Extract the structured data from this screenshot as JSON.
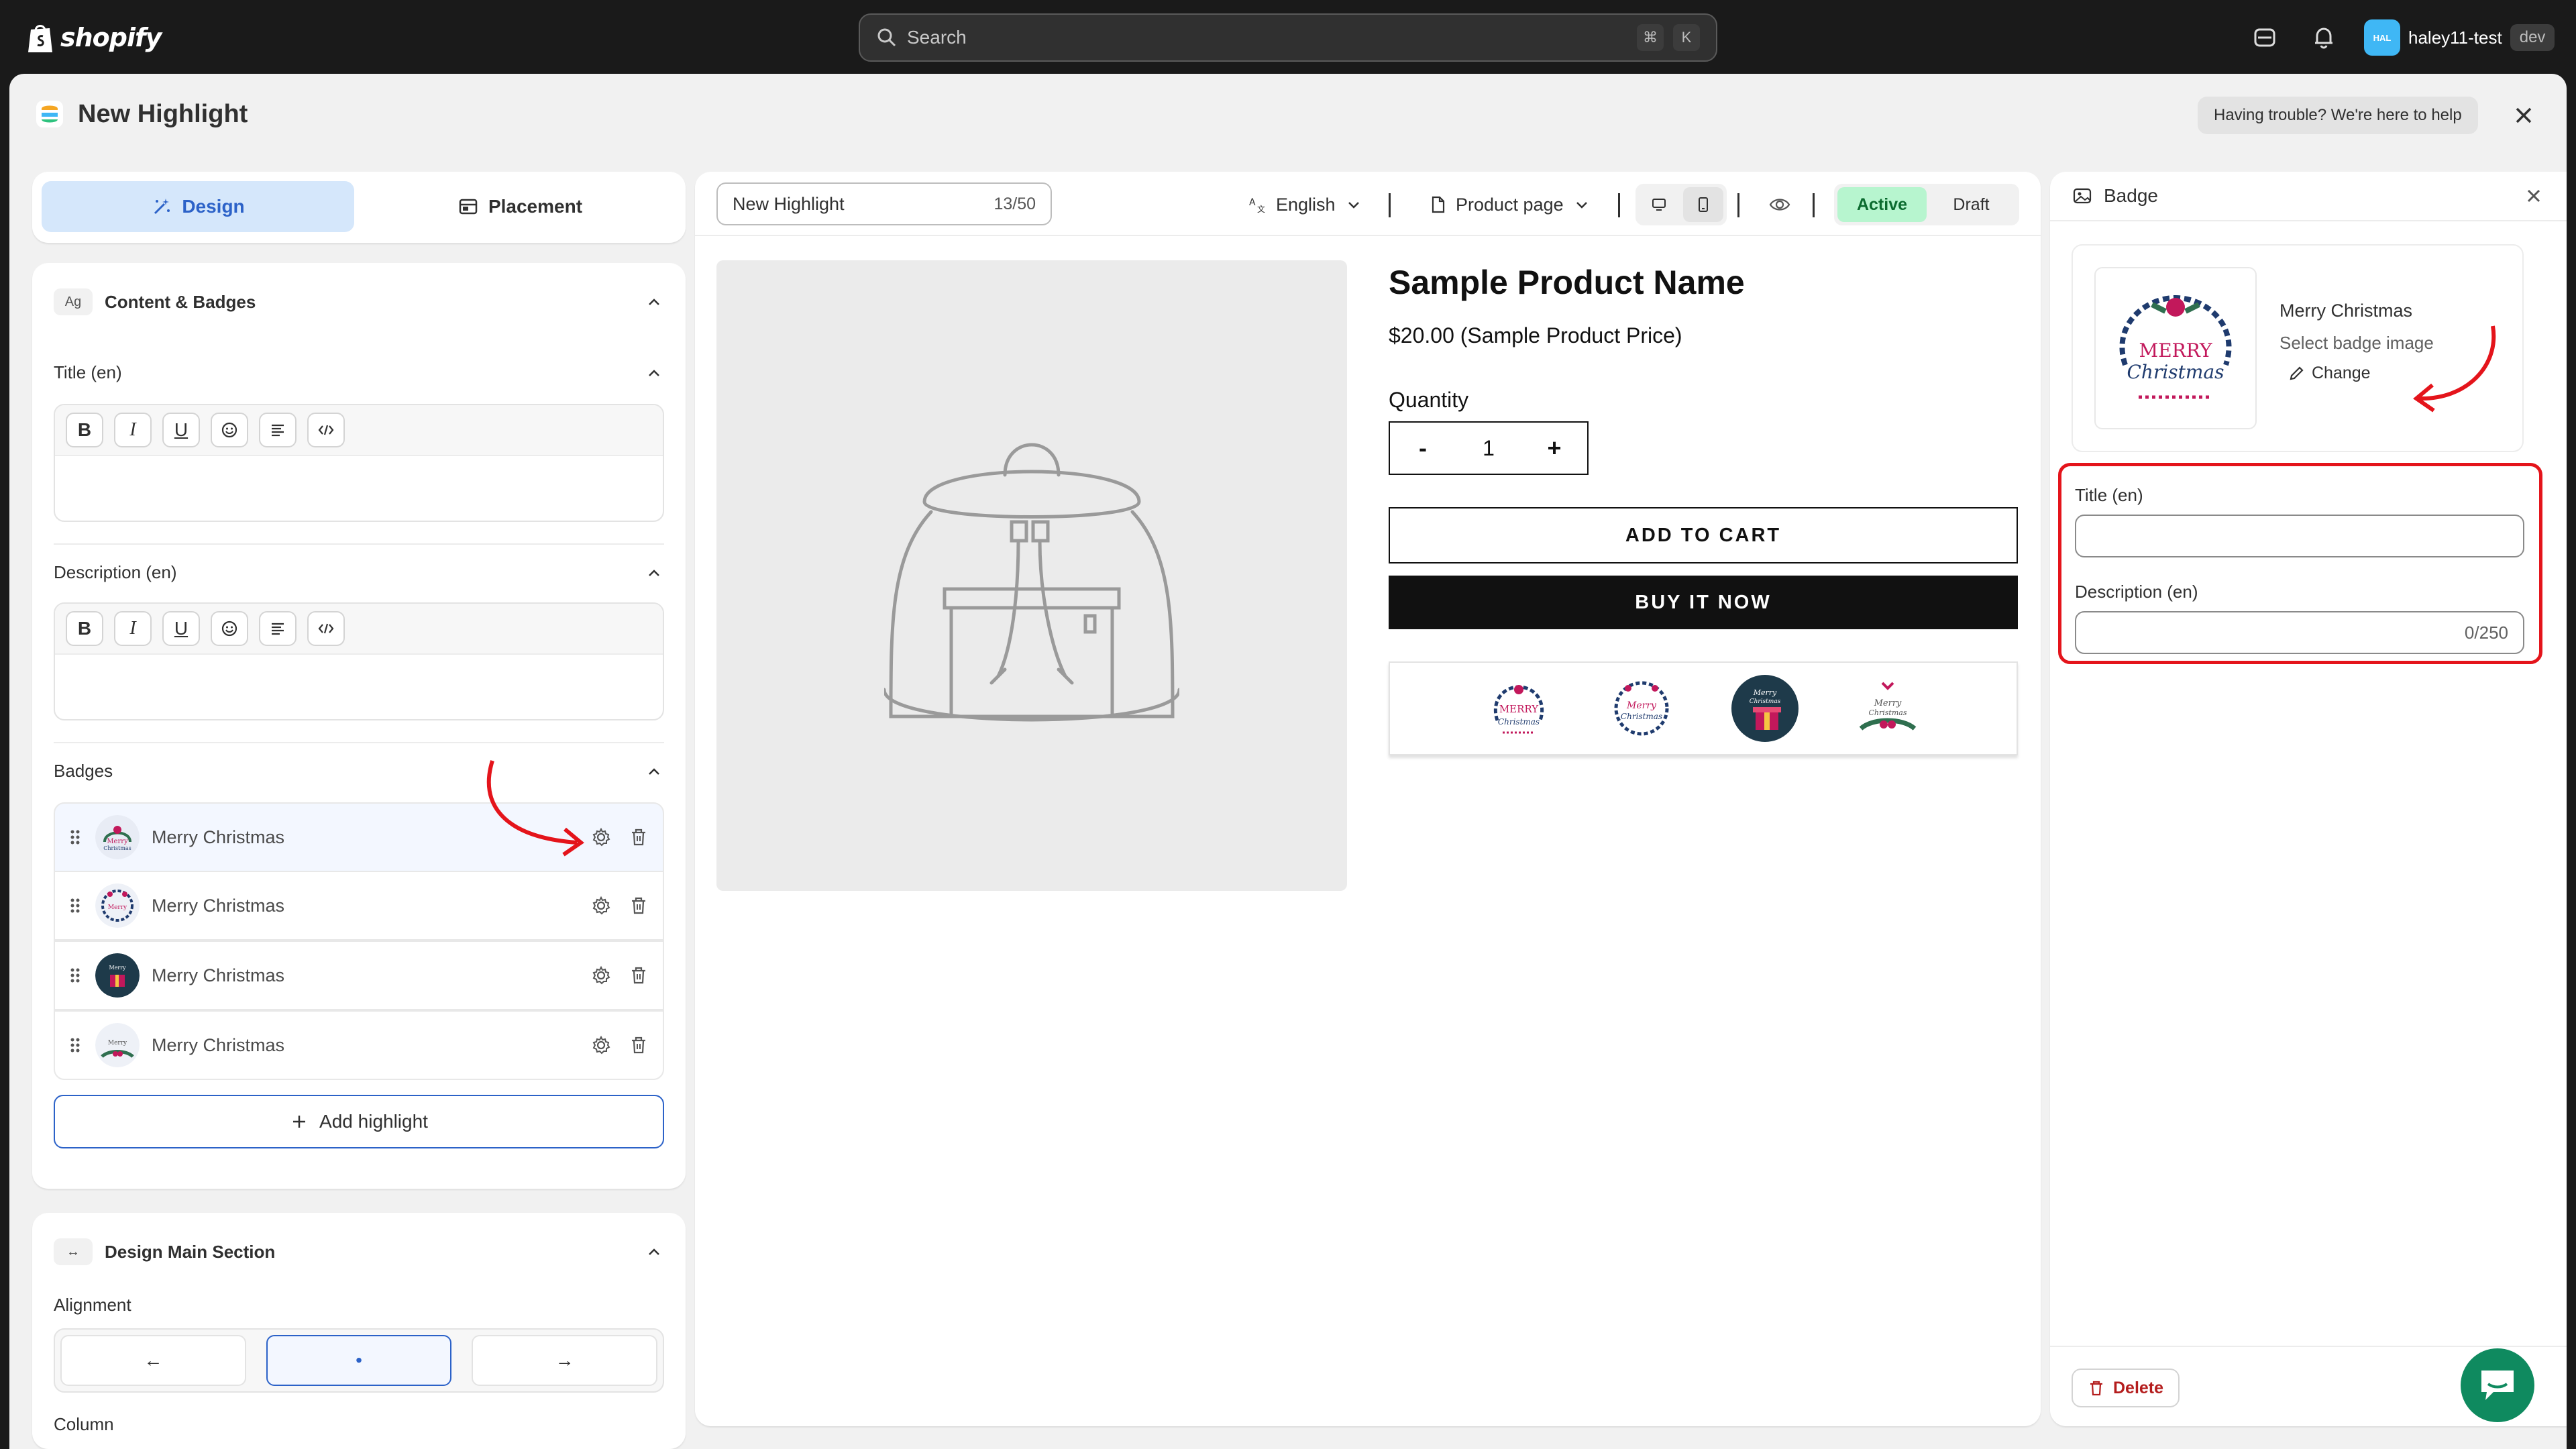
{
  "topbar": {
    "brand": "shopify",
    "search_placeholder": "Search",
    "shortcut_keys": [
      "⌘",
      "K"
    ],
    "store_avatar": "HAL",
    "store_name": "haley11-test",
    "store_tag": "dev"
  },
  "app": {
    "title": "New Highlight",
    "help_text": "Having trouble? We're here to help"
  },
  "left": {
    "tabs": [
      {
        "label": "Design",
        "icon": "magic-wand-icon",
        "active": true
      },
      {
        "label": "Placement",
        "icon": "layout-icon",
        "active": false
      }
    ],
    "content_section": {
      "title": "Content & Badges",
      "title_field_label": "Title (en)",
      "description_field_label": "Description (en)",
      "badges_label": "Badges",
      "badges": [
        {
          "name": "Merry Christmas"
        },
        {
          "name": "Merry Christmas"
        },
        {
          "name": "Merry Christmas"
        },
        {
          "name": "Merry Christmas"
        }
      ],
      "add_button": "Add highlight"
    },
    "design_main": {
      "title": "Design Main Section",
      "alignment_label": "Alignment",
      "alignment_options": [
        "←",
        "•",
        "→"
      ],
      "selected_alignment": "•",
      "next_label_partial": "Column"
    }
  },
  "preview": {
    "name_value": "New Highlight",
    "name_count": "13/50",
    "language": "English",
    "page_type": "Product page",
    "status_options": [
      "Active",
      "Draft"
    ],
    "status_selected": "Active",
    "product": {
      "name": "Sample Product Name",
      "price": "$20.00 (Sample Product Price)",
      "quantity_label": "Quantity",
      "quantity_value": "1",
      "minus": "-",
      "plus": "+",
      "add_to_cart": "ADD TO CART",
      "buy_now": "BUY IT NOW"
    }
  },
  "right_panel": {
    "title": "Badge",
    "badge_name": "Merry Christmas",
    "badge_sub": "Select badge image",
    "change_label": "Change",
    "badge_art_text": [
      "MERRY",
      "Christmas"
    ],
    "title_label": "Title (en)",
    "description_label": "Description (en)",
    "description_count": "0/250",
    "delete_label": "Delete"
  },
  "colors": {
    "accent_blue": "#2c62c8",
    "active_green": "#b7f5cf",
    "annotation_red": "#e4141b",
    "topbar": "#1a1a1a"
  }
}
